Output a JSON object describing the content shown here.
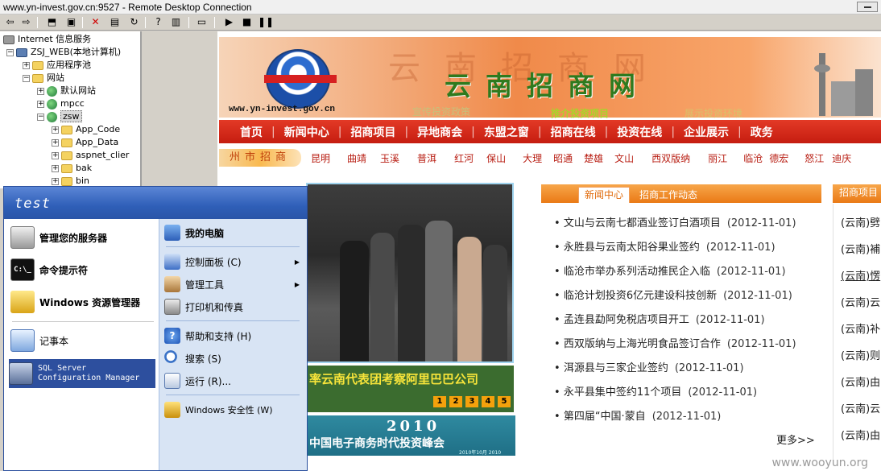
{
  "window": {
    "title": "www.yn-invest.gov.cn:9527 - Remote Desktop Connection"
  },
  "tree": {
    "root": "Internet 信息服务",
    "server": "ZSJ_WEB(本地计算机)",
    "app_pools": "应用程序池",
    "websites": "网站",
    "default_site": "默认网站",
    "mpcc": "mpcc",
    "zsw": "zsw",
    "children": [
      "App_Code",
      "App_Data",
      "aspnet_clier",
      "bak",
      "bin"
    ]
  },
  "start_menu": {
    "user": "test",
    "left": {
      "manage_server": "管理您的服务器",
      "cmd": "命令提示符",
      "explorer": "Windows 资源管理器",
      "notepad": "记事本",
      "sql": "SQL Server\nConfiguration Manager"
    },
    "right": {
      "my_computer": "我的电脑",
      "control_panel": "控制面板 (C)",
      "admin_tools": "管理工具",
      "printers": "打印机和传真",
      "help": "帮助和支持 (H)",
      "search": "搜索 (S)",
      "run": "运行 (R)...",
      "security": "Windows 安全性 (W)"
    }
  },
  "site": {
    "banner_text": "云南招商网",
    "banner_bg_text": "云南招商网",
    "url": "www.yn-invest.gov.cn",
    "slogan1": "宣传投资政策",
    "slogan2": "推介投资项目",
    "slogan3": "展示投资环境",
    "main_nav": [
      "首页",
      "新闻中心",
      "招商项目",
      "异地商会",
      "东盟之窗",
      "招商在线",
      "投资在线",
      "企业展示",
      "政务"
    ],
    "city_lead": "州市招商",
    "cities": [
      "昆明",
      "曲靖",
      "玉溪",
      "普洱",
      "红河",
      "保山",
      "大理",
      "昭通",
      "楚雄",
      "文山",
      "西双版纳",
      "丽江",
      "临沧",
      "德宏",
      "怒江",
      "迪庆"
    ],
    "photo_caption": "率云南代表团考察阿里巴巴公司",
    "pages": [
      "1",
      "2",
      "3",
      "4",
      "5"
    ],
    "ad_year": "2010",
    "ad_title": "中国电子商务时代投资峰会",
    "ad_date": "2010年10月 2010",
    "news_tab_active": "新闻中心",
    "news_tab_2": "招商工作动态",
    "news": [
      {
        "title": "文山与云南七都酒业签订白酒项目",
        "date": "(2012-11-01)"
      },
      {
        "title": "永胜县与云南太阳谷果业签约",
        "date": "(2012-11-01)"
      },
      {
        "title": "临沧市举办系列活动推民企入临",
        "date": "(2012-11-01)"
      },
      {
        "title": "临沧计划投资6亿元建设科技创新",
        "date": "(2012-11-01)"
      },
      {
        "title": "孟连县勐阿免税店项目开工",
        "date": "(2012-11-01)"
      },
      {
        "title": "西双版纳与上海光明食品签订合作",
        "date": "(2012-11-01)"
      },
      {
        "title": "洱源县与三家企业签约",
        "date": "(2012-11-01)"
      },
      {
        "title": "永平县集中签约11个项目",
        "date": "(2012-11-01)"
      },
      {
        "title": "第四届“中国·蒙自",
        "date": "(2012-11-01)"
      }
    ],
    "more": "更多>>",
    "right_header": "招商项目",
    "right_items": [
      "(云南)劈",
      "(云南)補",
      "(云南)愣",
      "(云南)云",
      "(云南)补",
      "(云南)则",
      "(云南)由",
      "(云南)云",
      "(云南)由"
    ]
  },
  "watermark": "www.wooyun.org"
}
